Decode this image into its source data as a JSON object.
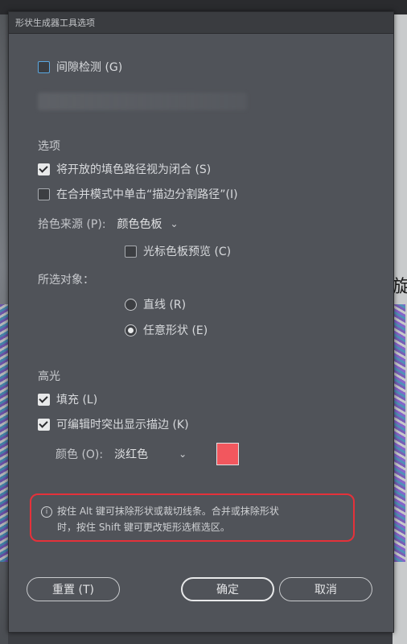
{
  "background": {
    "right_char": "旋"
  },
  "dialog": {
    "title": "形状生成器工具选项",
    "gap_detection_label": "间隙检测 (G)",
    "options_heading": "选项",
    "close_open_fill_label": "将开放的填色路径视为闭合 (S)",
    "merge_mode_click_label": "在合并模式中单击“描边分割路径”(I)",
    "pick_color_from_label": "拾色来源 (P):",
    "pick_color_from_value": "颜色色板",
    "cursor_swatch_preview_label": "光标色板预览 (C)",
    "selection_heading": "所选对象：",
    "radio_straight_label": "直线 (R)",
    "radio_freeform_label": "任意形状 (E)",
    "highlight_heading": "高光",
    "fill_label": "填充 (L)",
    "highlight_stroke_label": "可编辑时突出显示描边 (K)",
    "color_label": "颜色 (O):",
    "color_value": "淡红色",
    "swatch_color": "#f2575e",
    "info_line1": "按住 Alt 键可抹除形状或裁切线条。合并或抹除形状",
    "info_line2": "时，按住 Shift 键可更改矩形选框选区。",
    "reset_button": "重置 (T)",
    "ok_button": "确定",
    "cancel_button": "取消"
  }
}
